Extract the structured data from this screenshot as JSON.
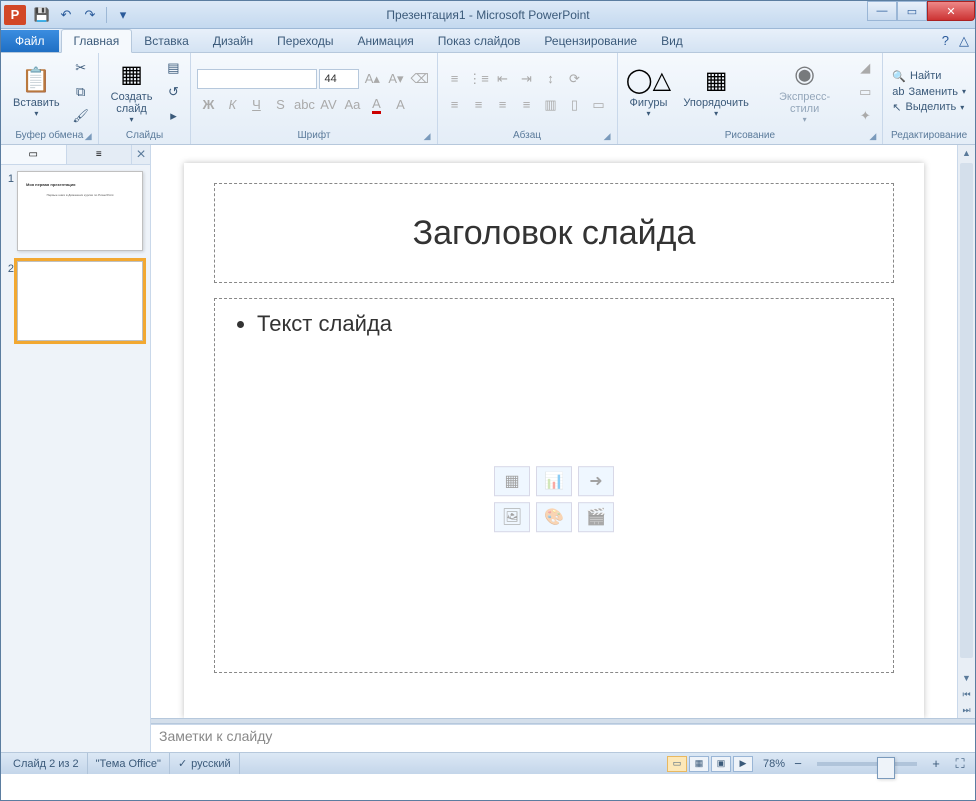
{
  "title": "Презентация1 - Microsoft PowerPoint",
  "qat": {
    "save": "💾",
    "undo": "↶",
    "redo": "↷"
  },
  "tabs": {
    "file": "Файл",
    "items": [
      "Главная",
      "Вставка",
      "Дизайн",
      "Переходы",
      "Анимация",
      "Показ слайдов",
      "Рецензирование",
      "Вид"
    ],
    "active": 0
  },
  "ribbon": {
    "clipboard": {
      "paste": "Вставить",
      "label": "Буфер обмена"
    },
    "slides": {
      "new": "Создать\nслайд",
      "label": "Слайды"
    },
    "font": {
      "size": "44",
      "label": "Шрифт"
    },
    "paragraph": {
      "label": "Абзац"
    },
    "drawing": {
      "shapes": "Фигуры",
      "arrange": "Упорядочить",
      "styles": "Экспресс-стили",
      "label": "Рисование"
    },
    "editing": {
      "find": "Найти",
      "replace": "Заменить",
      "select": "Выделить",
      "label": "Редактирование"
    }
  },
  "thumbnails": {
    "slides": [
      {
        "num": "1",
        "title": "Моя первая презентация",
        "sub": "Первые шаги в Домашних курсах по PowerPoint"
      },
      {
        "num": "2",
        "title": "",
        "sub": ""
      }
    ],
    "selected": 1
  },
  "slide": {
    "titlePlaceholder": "Заголовок слайда",
    "contentPlaceholder": "Текст слайда"
  },
  "notes": {
    "placeholder": "Заметки к слайду"
  },
  "status": {
    "slide": "Слайд 2 из 2",
    "theme": "\"Тема Office\"",
    "lang": "русский",
    "zoom": "78%"
  }
}
